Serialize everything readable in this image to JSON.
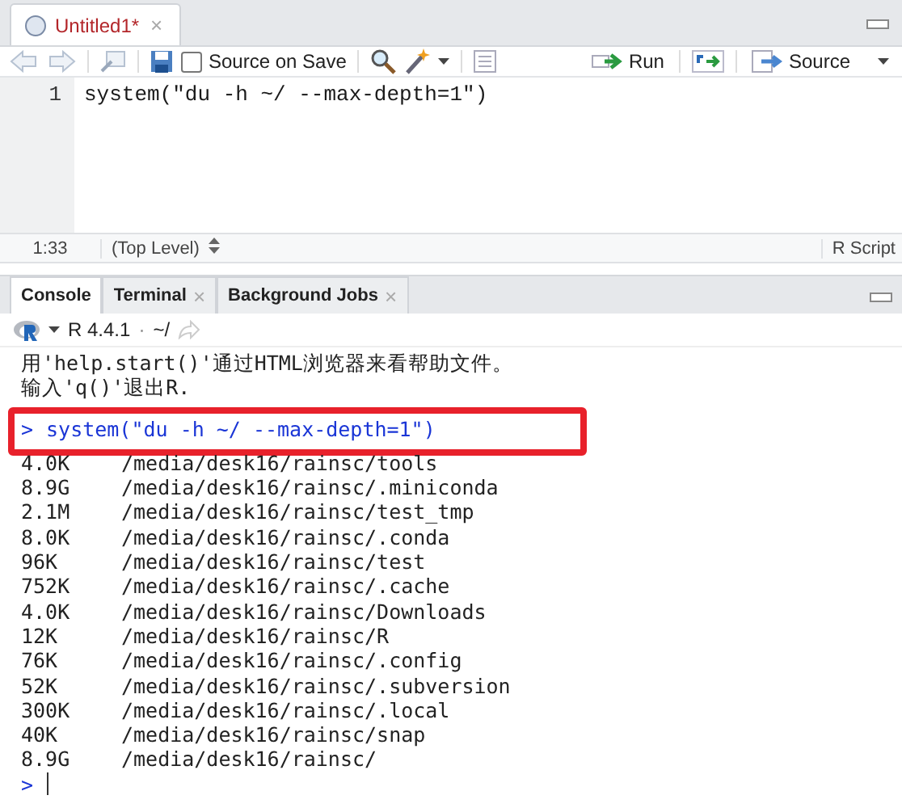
{
  "editor_tab": {
    "title": "Untitled1*",
    "close": "×"
  },
  "toolbar": {
    "source_on_save": {
      "label": "Source on Save",
      "checked": false
    },
    "run": "Run",
    "source": "Source"
  },
  "editor": {
    "lines": [
      {
        "number": "1",
        "code": "system(\"du -h ~/ --max-depth=1\")"
      }
    ]
  },
  "status_bar": {
    "position": "1:33",
    "scope": "(Top Level)",
    "file_type": "R Script"
  },
  "console_tabs": [
    {
      "label": "Console",
      "selected": true
    },
    {
      "label": "Terminal",
      "selected": false,
      "close": "×"
    },
    {
      "label": "Background Jobs",
      "selected": false,
      "close": "×"
    }
  ],
  "console_bar": {
    "version": "R 4.4.1",
    "separator": "·",
    "path": "~/"
  },
  "console": [
    {
      "kind": "text",
      "text": "用'help.start()'通过HTML浏览器来看帮助文件。"
    },
    {
      "kind": "text",
      "text": "输入'q()'退出R."
    },
    {
      "kind": "command",
      "prompt": ">",
      "text": "system(\"du -h ~/ --max-depth=1\")",
      "highlighted": true
    },
    {
      "kind": "output",
      "size": "4.0K",
      "path": "/media/desk16/rainsc/tools"
    },
    {
      "kind": "output",
      "size": "8.9G",
      "path": "/media/desk16/rainsc/.miniconda"
    },
    {
      "kind": "output",
      "size": "2.1M",
      "path": "/media/desk16/rainsc/test_tmp"
    },
    {
      "kind": "output",
      "size": "8.0K",
      "path": "/media/desk16/rainsc/.conda"
    },
    {
      "kind": "output",
      "size": "96K",
      "path": "/media/desk16/rainsc/test"
    },
    {
      "kind": "output",
      "size": "752K",
      "path": "/media/desk16/rainsc/.cache"
    },
    {
      "kind": "output",
      "size": "4.0K",
      "path": "/media/desk16/rainsc/Downloads"
    },
    {
      "kind": "output",
      "size": "12K",
      "path": "/media/desk16/rainsc/R"
    },
    {
      "kind": "output",
      "size": "76K",
      "path": "/media/desk16/rainsc/.config"
    },
    {
      "kind": "output",
      "size": "52K",
      "path": "/media/desk16/rainsc/.subversion"
    },
    {
      "kind": "output",
      "size": "300K",
      "path": "/media/desk16/rainsc/.local"
    },
    {
      "kind": "output",
      "size": "40K",
      "path": "/media/desk16/rainsc/snap"
    },
    {
      "kind": "output",
      "size": "8.9G",
      "path": "/media/desk16/rainsc/"
    },
    {
      "kind": "prompt",
      "prompt": ">"
    }
  ]
}
